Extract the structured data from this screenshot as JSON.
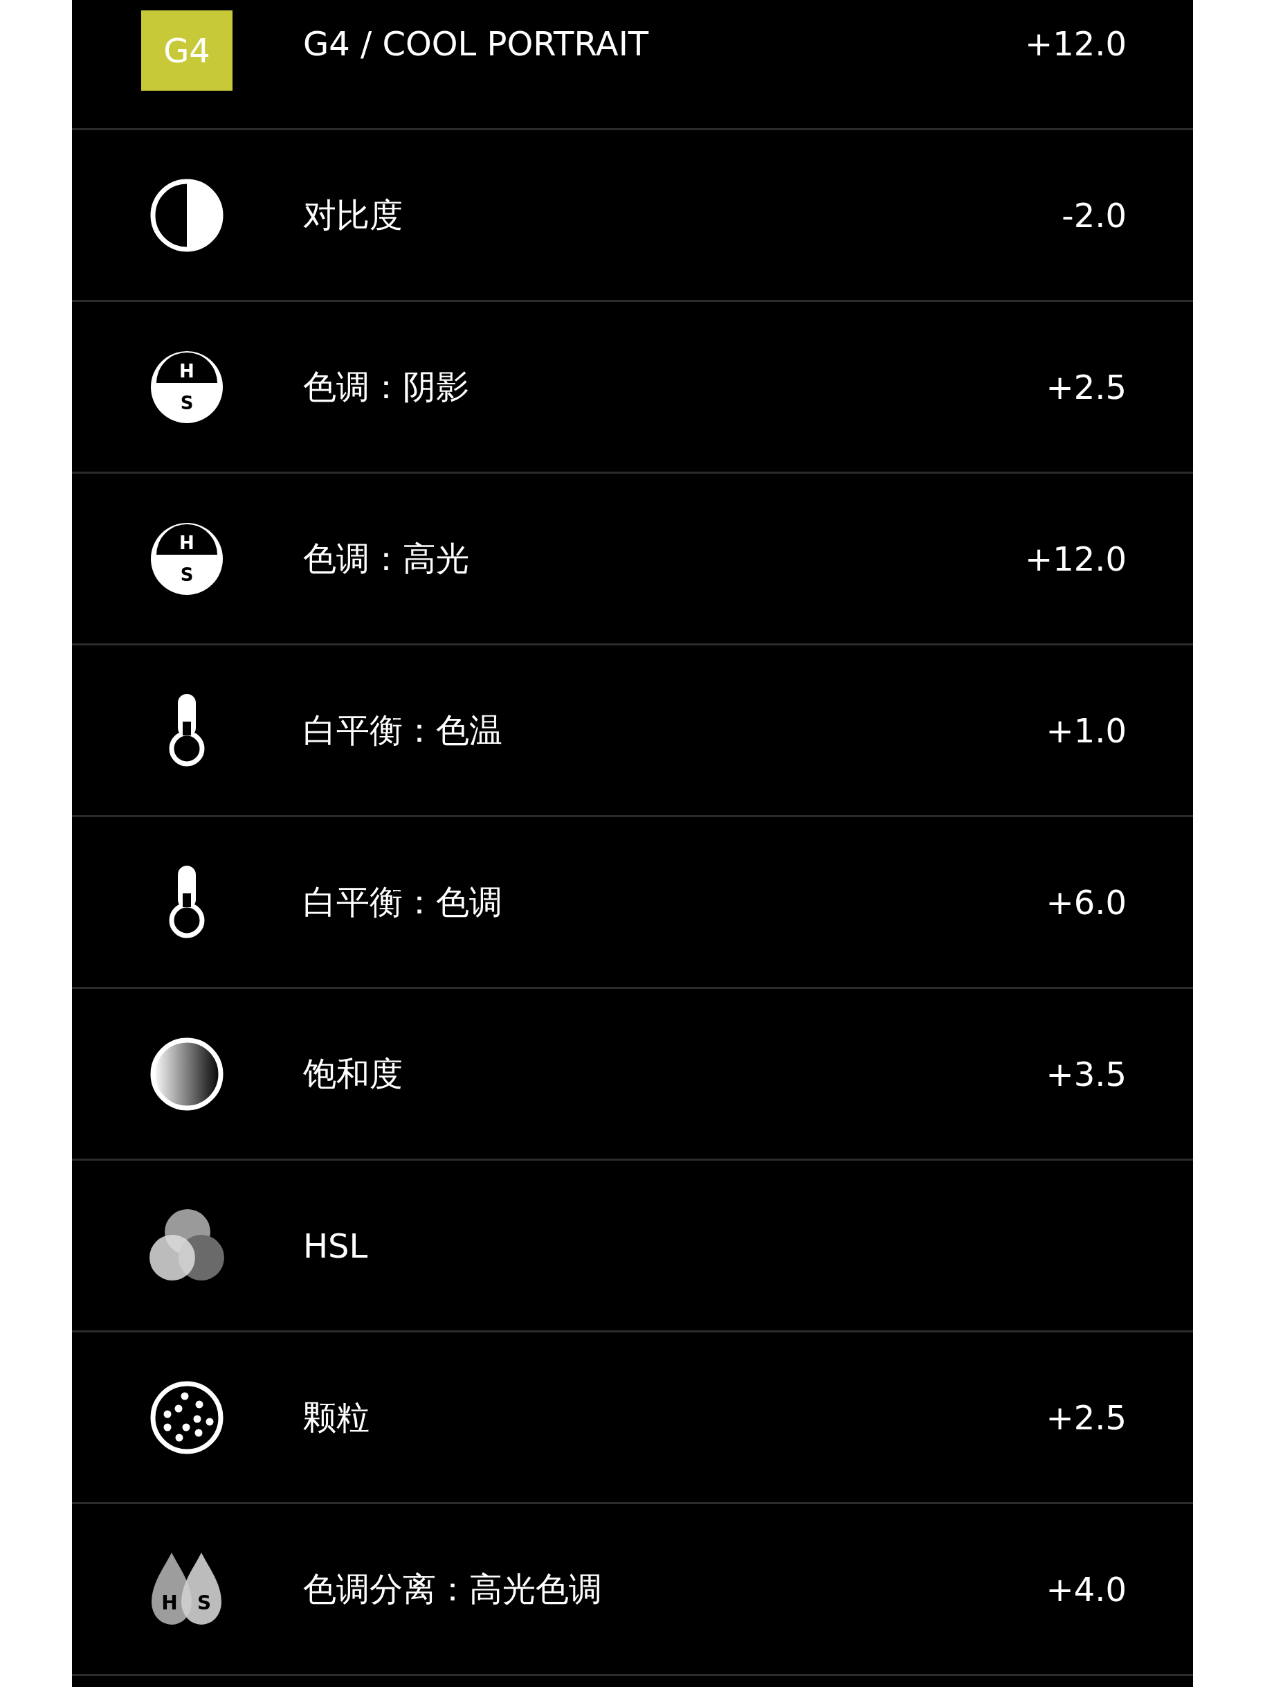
{
  "adjustments": [
    {
      "kind": "badge",
      "badge": "G4",
      "label": "G4 / COOL PORTRAIT",
      "value": "+12.0"
    },
    {
      "kind": "contrast",
      "label": "对比度",
      "value": "-2.0"
    },
    {
      "kind": "hs",
      "icon_letters": [
        "H",
        "S"
      ],
      "label": "色调：阴影",
      "value": "+2.5"
    },
    {
      "kind": "hs",
      "icon_letters": [
        "H",
        "S"
      ],
      "label": "色调：高光",
      "value": "+12.0"
    },
    {
      "kind": "thermometer",
      "label": "白平衡：色温",
      "value": "+1.0"
    },
    {
      "kind": "thermometer",
      "label": "白平衡：色调",
      "value": "+6.0"
    },
    {
      "kind": "saturation",
      "label": "饱和度",
      "value": "+3.5"
    },
    {
      "kind": "hsl",
      "label": "HSL"
    },
    {
      "kind": "grain",
      "label": "颗粒",
      "value": "+2.5"
    },
    {
      "kind": "split",
      "icon_letters": [
        "H",
        "S"
      ],
      "label": "色调分离：高光色调",
      "value": "+4.0"
    }
  ]
}
